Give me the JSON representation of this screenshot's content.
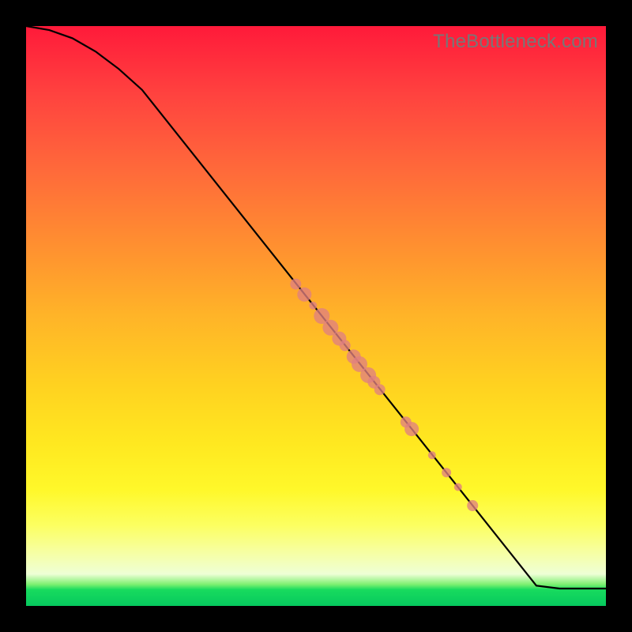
{
  "watermark": "TheBottleneck.com",
  "colors": {
    "page_bg": "#000000",
    "curve": "#000000",
    "marker": "#e08080",
    "gradient_stops": [
      "#ff1a3a",
      "#ff6a3a",
      "#ffb428",
      "#fff82a",
      "#eeffd6",
      "#18db5e"
    ]
  },
  "chart_data": {
    "type": "line",
    "title": "",
    "xlabel": "",
    "ylabel": "",
    "xlim": [
      0,
      100
    ],
    "ylim": [
      0,
      100
    ],
    "grid": false,
    "legend": false,
    "series": [
      {
        "name": "curve",
        "kind": "line",
        "x": [
          0,
          4,
          8,
          12,
          16,
          20,
          88,
          92,
          100
        ],
        "y": [
          100,
          99.3,
          97.9,
          95.6,
          92.6,
          89,
          3.5,
          3,
          3
        ]
      },
      {
        "name": "markers",
        "kind": "scatter",
        "points": [
          {
            "x": 46.5,
            "y": 55.5,
            "r": 7
          },
          {
            "x": 48.0,
            "y": 53.7,
            "r": 9
          },
          {
            "x": 49.5,
            "y": 51.8,
            "r": 5
          },
          {
            "x": 51.0,
            "y": 50.0,
            "r": 10
          },
          {
            "x": 52.5,
            "y": 48.0,
            "r": 10
          },
          {
            "x": 54.0,
            "y": 46.1,
            "r": 9
          },
          {
            "x": 55.0,
            "y": 44.9,
            "r": 7
          },
          {
            "x": 56.5,
            "y": 43.0,
            "r": 9
          },
          {
            "x": 57.5,
            "y": 41.7,
            "r": 10
          },
          {
            "x": 59.0,
            "y": 39.8,
            "r": 10
          },
          {
            "x": 60.0,
            "y": 38.6,
            "r": 8
          },
          {
            "x": 61.0,
            "y": 37.3,
            "r": 7
          },
          {
            "x": 65.5,
            "y": 31.7,
            "r": 7
          },
          {
            "x": 66.5,
            "y": 30.5,
            "r": 9
          },
          {
            "x": 70.0,
            "y": 26.0,
            "r": 5
          },
          {
            "x": 72.5,
            "y": 23.0,
            "r": 6
          },
          {
            "x": 74.5,
            "y": 20.5,
            "r": 5
          },
          {
            "x": 77.0,
            "y": 17.3,
            "r": 7
          }
        ]
      }
    ]
  }
}
